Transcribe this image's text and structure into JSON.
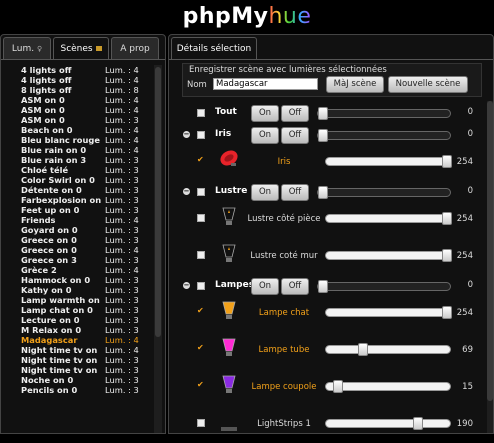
{
  "logo": {
    "part1": "phpMy",
    "part2": "hue"
  },
  "left_tabs": [
    {
      "label": "Lum.",
      "icon": "bulb-icon"
    },
    {
      "label": "Scènes",
      "icon": "scene-icon"
    },
    {
      "label": "A prop"
    }
  ],
  "scenes": [
    {
      "name": "4 lights off",
      "lum": "Lum. : 4"
    },
    {
      "name": "4 lights off",
      "lum": "Lum. : 4"
    },
    {
      "name": "8 lights off",
      "lum": "Lum. : 8"
    },
    {
      "name": "ASM on 0",
      "lum": "Lum. : 4"
    },
    {
      "name": "ASM on 0",
      "lum": "Lum. : 4"
    },
    {
      "name": "ASM on 0",
      "lum": "Lum. : 3"
    },
    {
      "name": "Beach on 0",
      "lum": "Lum. : 4"
    },
    {
      "name": "Bleu blanc rouge",
      "lum": "Lum. : 4"
    },
    {
      "name": "Blue rain on 0",
      "lum": "Lum. : 4"
    },
    {
      "name": "Blue rain on 3",
      "lum": "Lum. : 3"
    },
    {
      "name": "Chloé télé",
      "lum": "Lum. : 3"
    },
    {
      "name": "Color Swirl on 0",
      "lum": "Lum. : 3"
    },
    {
      "name": "Détente on 0",
      "lum": "Lum. : 3"
    },
    {
      "name": "Farbexplosion on",
      "lum": "Lum. : 3"
    },
    {
      "name": "Feet up on 0",
      "lum": "Lum. : 3"
    },
    {
      "name": "Friends",
      "lum": "Lum. : 4"
    },
    {
      "name": "Goyard on 0",
      "lum": "Lum. : 3"
    },
    {
      "name": "Greece on 0",
      "lum": "Lum. : 3"
    },
    {
      "name": "Greece on 0",
      "lum": "Lum. : 4"
    },
    {
      "name": "Greece on 3",
      "lum": "Lum. : 3"
    },
    {
      "name": "Grèce 2",
      "lum": "Lum. : 4"
    },
    {
      "name": "Hammock on 0",
      "lum": "Lum. : 3"
    },
    {
      "name": "Kathy on 0",
      "lum": "Lum. : 3"
    },
    {
      "name": "Lamp warmth on",
      "lum": "Lum. : 3"
    },
    {
      "name": "Lamp chat on 0",
      "lum": "Lum. : 3"
    },
    {
      "name": "Lecture on 0",
      "lum": "Lum. : 3"
    },
    {
      "name": "M Relax on 0",
      "lum": "Lum. : 3"
    },
    {
      "name": "Madagascar",
      "lum": "Lum. : 4",
      "selected": true
    },
    {
      "name": "Night time tv on",
      "lum": "Lum. : 4"
    },
    {
      "name": "Night time tv on",
      "lum": "Lum. : 3"
    },
    {
      "name": "Night time tv on",
      "lum": "Lum. : 3"
    },
    {
      "name": "Noche on 0",
      "lum": "Lum. : 3"
    },
    {
      "name": "Pencils on 0",
      "lum": "Lum. : 3"
    }
  ],
  "right_tab": "Détails sélection",
  "save": {
    "title": "Enregistrer scène avec lumières sélectionnées",
    "name_label": "Nom",
    "name_value": "Madagascar",
    "update_button": "MàJ scène",
    "new_button": "Nouvelle scène"
  },
  "buttons": {
    "on": "On",
    "off": "Off"
  },
  "groups": [
    {
      "name": "Tout",
      "value": "0",
      "level": 0,
      "toggle": ""
    },
    {
      "name": "Iris",
      "value": "0",
      "level": 0,
      "toggle": "−",
      "lights": [
        {
          "name": "Iris",
          "value": "254",
          "level": 254,
          "on": true,
          "color": "#e8232a",
          "icon": "iris-lamp-icon"
        }
      ]
    },
    {
      "name": "Lustre",
      "value": "0",
      "level": 0,
      "toggle": "−",
      "lights": [
        {
          "name": "Lustre côté pièce",
          "value": "254",
          "level": 254,
          "on": false,
          "color": "#f2a11a",
          "icon": "bulb-icon"
        },
        {
          "name": "Lustre coté mur",
          "value": "254",
          "level": 254,
          "on": false,
          "color": "#f2a11a",
          "icon": "bulb-icon"
        }
      ]
    },
    {
      "name": "Lampes",
      "value": "0",
      "level": 0,
      "toggle": "−",
      "lights": [
        {
          "name": "Lampe chat",
          "value": "254",
          "level": 254,
          "on": true,
          "color": "#f2a11a",
          "icon": "bulb-icon"
        },
        {
          "name": "Lampe tube",
          "value": "69",
          "level": 69,
          "on": true,
          "color": "#ff2ad4",
          "icon": "bulb-icon"
        },
        {
          "name": "Lampe coupole",
          "value": "15",
          "level": 15,
          "on": true,
          "color": "#8a2be2",
          "icon": "bulb-icon"
        },
        {
          "name": "LightStrips 1",
          "value": "190",
          "level": 190,
          "on": false,
          "color": "#888888",
          "icon": "lightstrip-icon"
        }
      ]
    }
  ]
}
